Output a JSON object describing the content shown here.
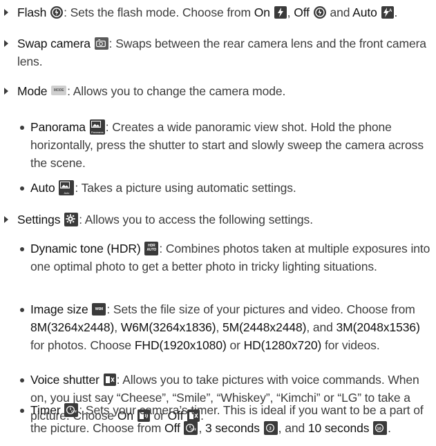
{
  "items": {
    "flash": {
      "term": "Flash",
      "desc": ": Sets the flash mode. Choose from ",
      "opt_on": "On",
      "opt_off": "Off",
      "and": "and",
      "opt_auto": "Auto",
      "end": "."
    },
    "swap": {
      "term": "Swap camera",
      "desc": ": Swaps between the rear camera lens and the front camera lens."
    },
    "mode": {
      "term": "Mode",
      "icon_label": "MODE",
      "desc": ": Allows you to change the camera mode."
    },
    "panorama": {
      "term": "Panorama",
      "icon_label": "Panorama",
      "desc": ": Creates a wide panoramic view shot. Hold the phone horizontally, press the shutter to start and slowly sweep the camera across the scene."
    },
    "auto": {
      "term": "Auto",
      "icon_label": "Auto",
      "desc": ": Takes a picture using automatic settings."
    },
    "settings": {
      "term": "Settings",
      "desc": ": Allows you to access the following settings."
    },
    "hdr": {
      "term": "Dynamic tone (HDR)",
      "icon_label": "HDR AUTO",
      "desc": ": Combines photos taken at multiple exposures into one optimal photo to get a better photo in tricky lighting situations."
    },
    "image_size": {
      "term": "Image size",
      "icon_label": "W6M",
      "desc1": ": Sets the file size of your pictures and video. Choose from ",
      "s1": "8M(3264x2448)",
      "c1": ", ",
      "s2": "W6M(3264x1836)",
      "c2": ", ",
      "s3": "5M(2448x2448)",
      "c3": ", and ",
      "s4": "3M(2048x1536)",
      "c4": " for photos. Choose ",
      "s5": "FHD(1920x1080)",
      "c5": " or ",
      "s6": "HD(1280x720)",
      "c6": " for videos."
    },
    "voice": {
      "term": "Voice shutter",
      "desc": ": Allows you to take pictures with voice commands. When on, you just say “Cheese”, “Smile”, “Whiskey”, “Kimchi” or “LG” to take a picture. Choose ",
      "opt_on": "On",
      "or": "or",
      "opt_off": "Off",
      "end": "."
    },
    "timer": {
      "term": "Timer",
      "desc": ": Sets your camera’s timer. This is ideal if you want to be a part of the picture. Choose from ",
      "opt_off": "Off",
      "c1": ", ",
      "opt_3": "3 seconds",
      "c2": ", and ",
      "opt_10": "10 seconds",
      "end": "."
    }
  },
  "icons": {
    "flash": "flash-auto-icon",
    "swap": "swap-camera-icon",
    "settings": "gear-icon",
    "timer": "timer-icon",
    "voice": "voice-shutter-icon"
  },
  "colors": {
    "text": "#3c3c3c",
    "icon_dark": "#3a3a3a"
  }
}
